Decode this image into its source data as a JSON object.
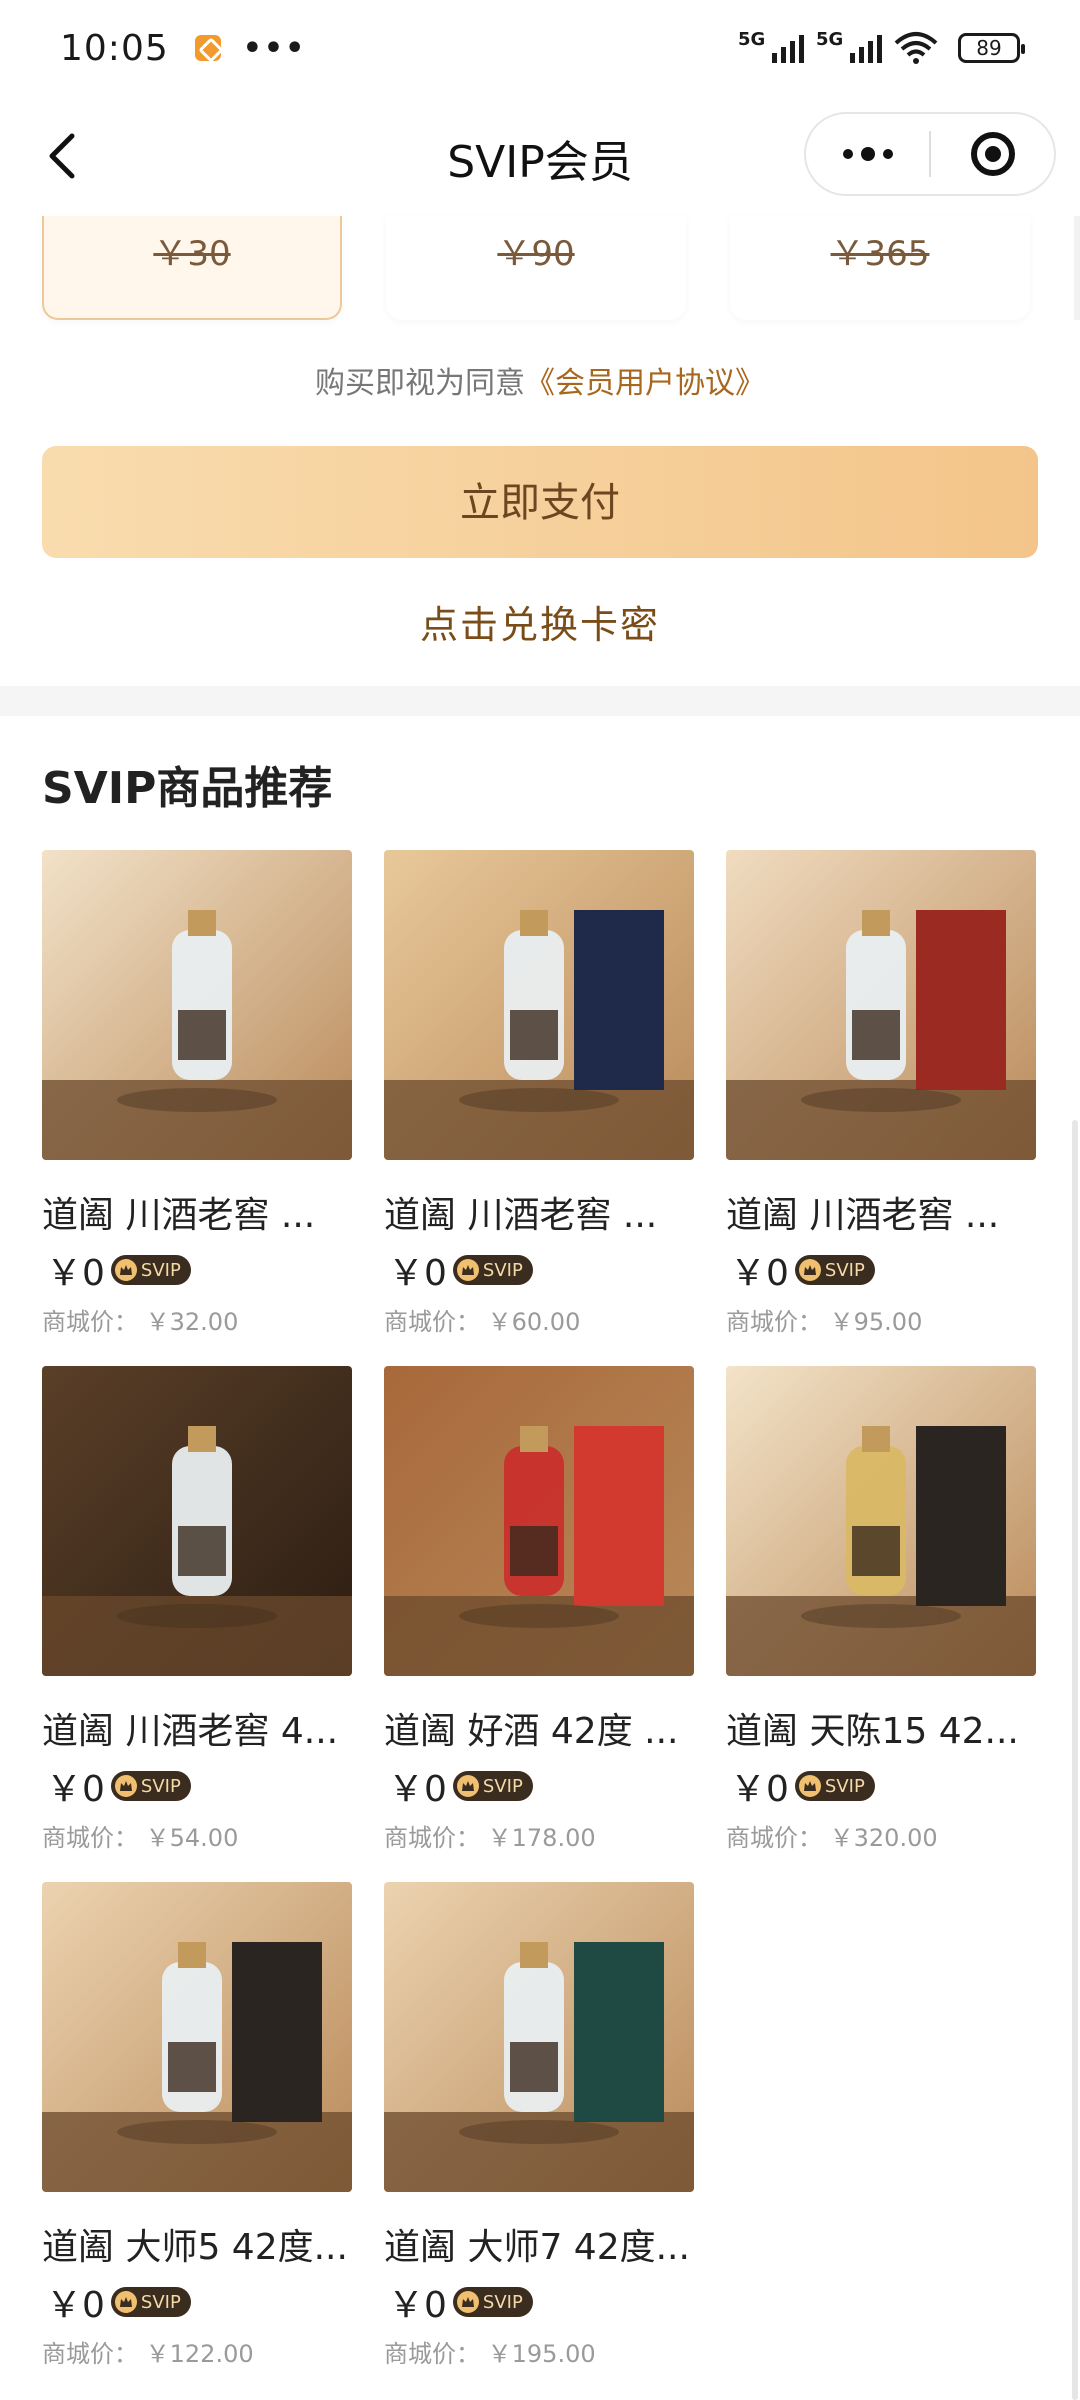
{
  "status": {
    "time": "10:05",
    "more": "•••",
    "battery": "89",
    "sim1": "5G",
    "sim2": "5G"
  },
  "nav": {
    "title": "SVIP会员",
    "back_icon": "chevron-left-icon"
  },
  "plans": [
    {
      "original_price": "￥30",
      "selected": true
    },
    {
      "original_price": "￥90",
      "selected": false
    },
    {
      "original_price": "￥365",
      "selected": false
    }
  ],
  "agreement": {
    "prefix": "购买即视为同意",
    "link": "《会员用户协议》"
  },
  "pay_button": "立即支付",
  "redeem_link": "点击兑换卡密",
  "section_title": "SVIP商品推荐",
  "badge_label": "SVIP",
  "mall_label": "商城价：",
  "products": [
    {
      "name": "道阖 川酒老窖 ...",
      "price": "￥0",
      "mall_price": "￥32.00",
      "color": "#f2e2c8"
    },
    {
      "name": "道阖 川酒老窖 ...",
      "price": "￥0",
      "mall_price": "￥60.00",
      "color": "#e8c89a"
    },
    {
      "name": "道阖 川酒老窖 ...",
      "price": "￥0",
      "mall_price": "￥95.00",
      "color": "#f0dcc0"
    },
    {
      "name": "道阖 川酒老窖 4...",
      "price": "￥0",
      "mall_price": "￥54.00",
      "color": "#5a3f28"
    },
    {
      "name": "道阖 好酒 42度 ...",
      "price": "￥0",
      "mall_price": "￥178.00",
      "color": "#a8683a"
    },
    {
      "name": "道阖 天陈15 42...",
      "price": "￥0",
      "mall_price": "￥320.00",
      "color": "#f3e3c8"
    },
    {
      "name": "道阖 大师5 42度...",
      "price": "￥0",
      "mall_price": "￥122.00",
      "color": "#ecd3b0"
    },
    {
      "name": "道阖 大师7 42度...",
      "price": "￥0",
      "mall_price": "￥195.00",
      "color": "#ecd3b0"
    }
  ]
}
